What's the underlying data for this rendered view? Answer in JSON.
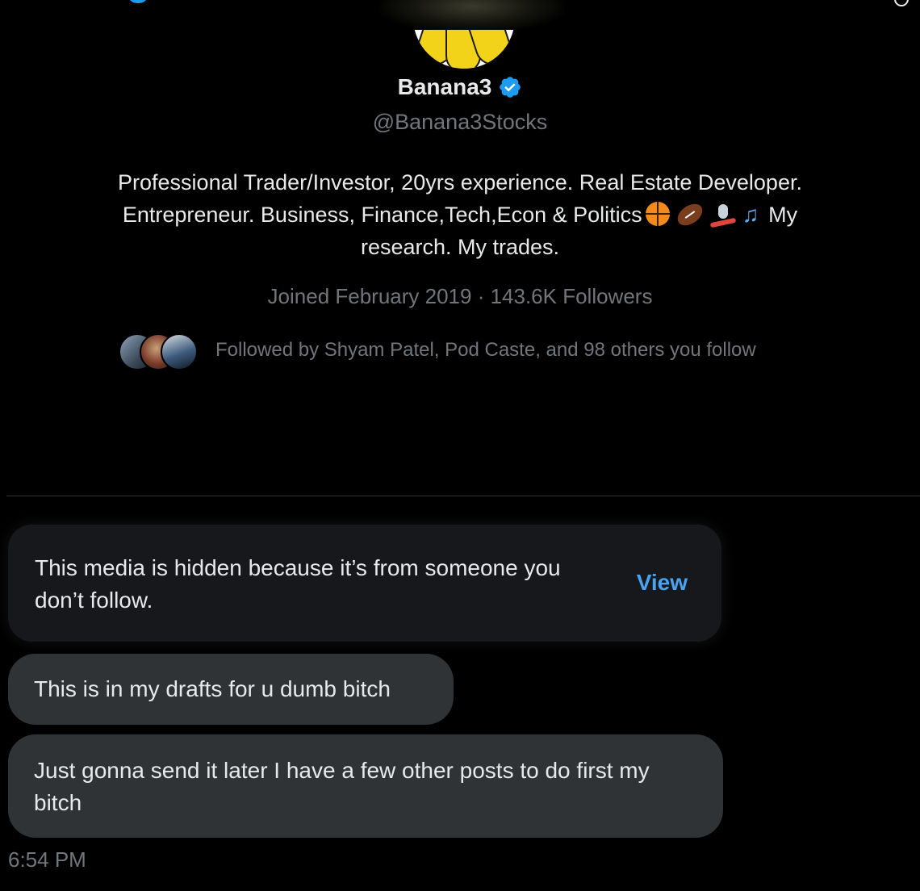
{
  "profile": {
    "name": "Banana3",
    "handle": "@Banana3Stocks",
    "bio_line1": "Professional Trader/Investor, 20yrs experience. Real Estate Developer.",
    "bio_line2_text": "Entrepreneur. Business, Finance,Tech,Econ & Politics",
    "bio_line2_end": "My",
    "bio_line3": "research. My trades.",
    "bio_emojis": [
      "basketball-icon",
      "football-icon",
      "snowboarder-icon",
      "music-notes-icon"
    ],
    "joined": "Joined February 2019 · 143.6K Followers",
    "followed_by": "Followed by Shyam Patel, Pod Caste, and 98 others you follow",
    "verified_color": "#1d9bf0"
  },
  "conversation": {
    "hidden_media_text": "This media is hidden because it’s from someone you don’t follow.",
    "view_label": "View",
    "messages": [
      "This is in my drafts for u dumb bitch",
      "Just gonna send it later I have a few other posts to do first my bitch"
    ],
    "timestamp": "6:54 PM"
  },
  "colors": {
    "background": "#000000",
    "text": "#e7e9ea",
    "muted": "#71767b",
    "bubble": "#2f3336",
    "link": "#4aa3ef"
  }
}
